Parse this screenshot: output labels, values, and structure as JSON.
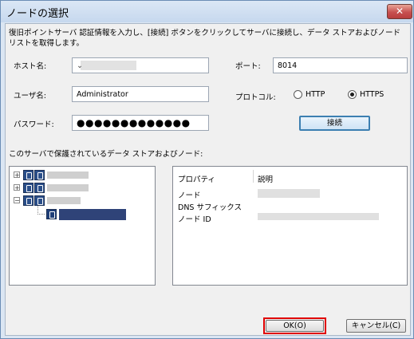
{
  "window": {
    "title": "ノードの選択",
    "close_glyph": "✕"
  },
  "instructions": "復旧ポイントサーバ 認証情報を入力し、[接続] ボタンをクリックしてサーバに接続し、データ ストアおよびノードリストを取得します。",
  "form": {
    "host_label": "ホスト名:",
    "port_label": "ポート:",
    "port_value": "8014",
    "username_label": "ユーザ名:",
    "username_value": "Administrator",
    "protocol_label": "プロトコル:",
    "protocol_options": [
      "HTTP",
      "HTTPS"
    ],
    "protocol_selected": "HTTPS",
    "password_label": "パスワード:",
    "password_value": "●●●●●●●●●●●●●",
    "connect_label": "接続"
  },
  "tree": {
    "heading": "このサーバで保護されているデータ ストアおよびノード:"
  },
  "properties": {
    "col_property": "プロパティ",
    "col_description": "説明",
    "rows": [
      {
        "name": "ノード"
      },
      {
        "name": "DNS サフィックス"
      },
      {
        "name": "ノード ID"
      }
    ]
  },
  "footer": {
    "ok_label": "OK(O)",
    "cancel_label": "キャンセル(C)"
  },
  "colors": {
    "highlight_box": "#e00000",
    "accent": "#3c7fb1"
  }
}
